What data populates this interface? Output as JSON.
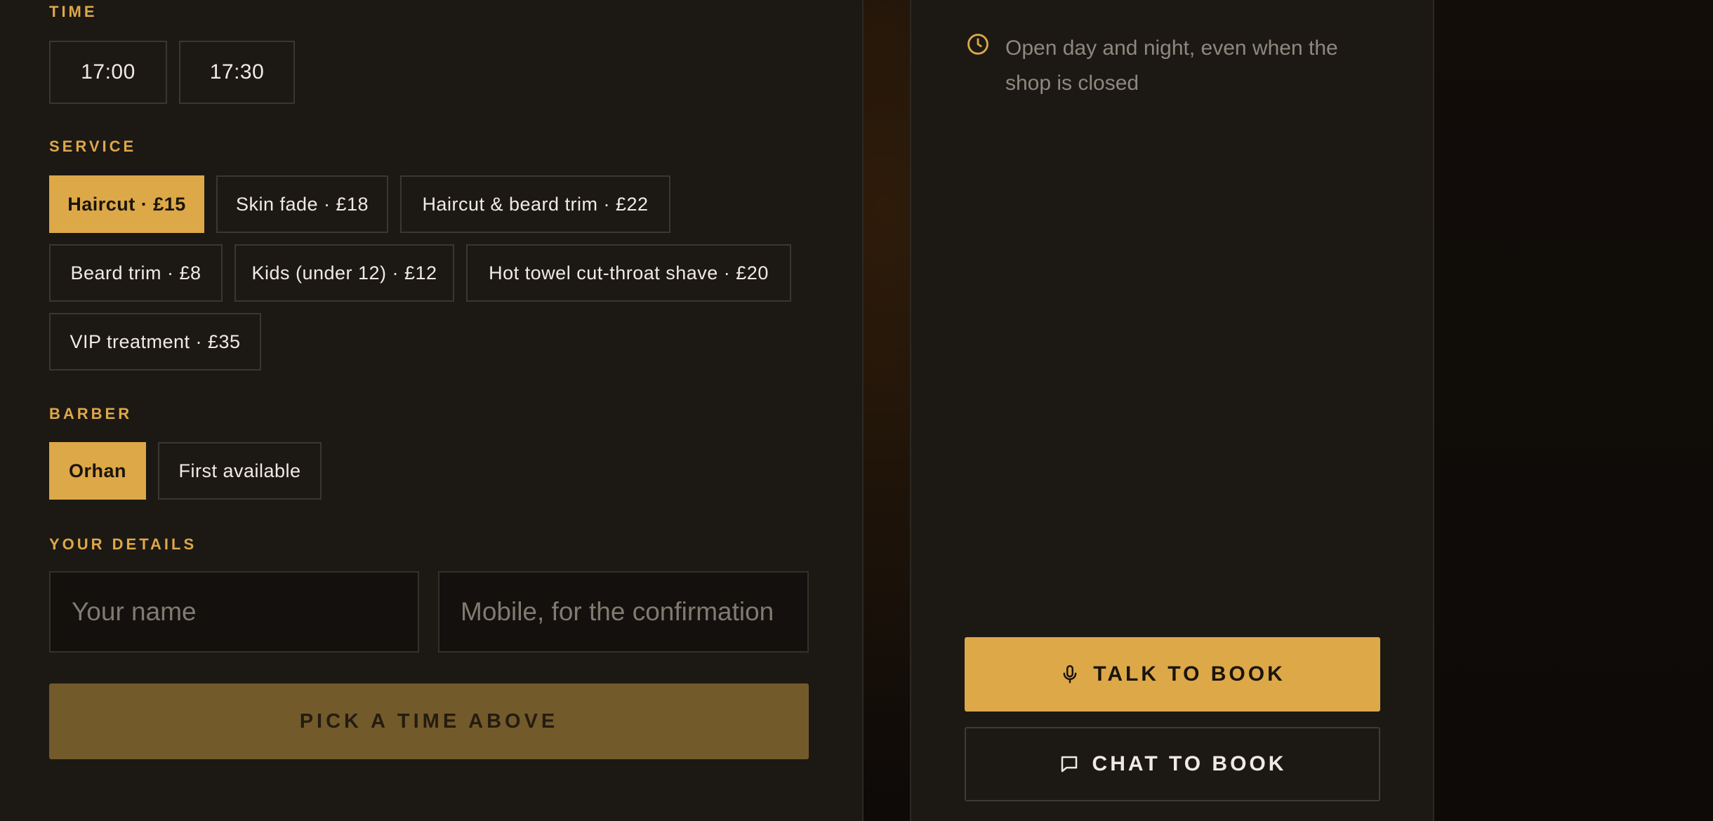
{
  "booking": {
    "time": {
      "label": "TIME",
      "slots": [
        "17:00",
        "17:30"
      ]
    },
    "service": {
      "label": "SERVICE",
      "options": [
        "Haircut · £15",
        "Skin fade · £18",
        "Haircut & beard trim · £22",
        "Beard trim · £8",
        "Kids (under 12) · £12",
        "Hot towel cut-throat shave · £20",
        "VIP treatment · £35"
      ],
      "selected": "Haircut · £15"
    },
    "barber": {
      "label": "BARBER",
      "options": [
        "Orhan",
        "First available"
      ],
      "selected": "Orhan"
    },
    "details": {
      "label": "YOUR DETAILS",
      "name_placeholder": "Your name",
      "name_value": "",
      "mobile_placeholder": "Mobile, for the confirmation",
      "mobile_value": ""
    },
    "submit_label": "PICK A TIME ABOVE"
  },
  "sidebar": {
    "hours_icon": "clock-icon",
    "hours_text": "Open day and night, even when the shop is closed",
    "talk_icon": "microphone-icon",
    "talk_label": "TALK TO BOOK",
    "chat_icon": "chat-bubble-icon",
    "chat_label": "CHAT TO BOOK"
  },
  "colors": {
    "accent": "#dda848",
    "panel": "#1c1814",
    "muted_text": "#8f887e"
  }
}
